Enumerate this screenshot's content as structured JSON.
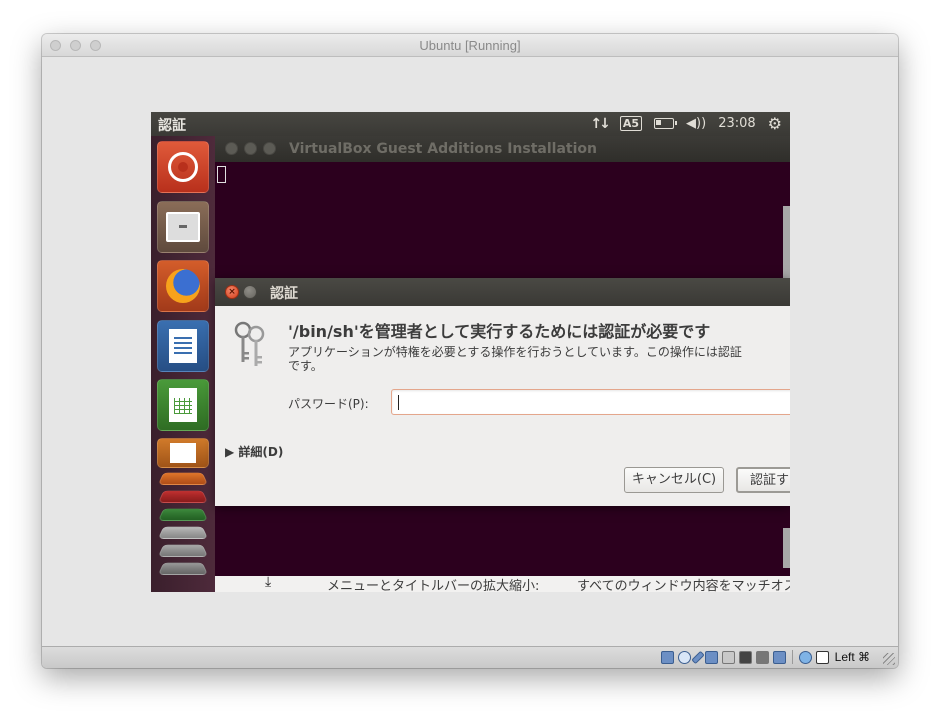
{
  "mac_window": {
    "title": "Ubuntu [Running]",
    "status_bar": {
      "host_key": "Left ⌘"
    }
  },
  "ubuntu": {
    "panel": {
      "title": "認証",
      "time": "23:08",
      "keyboard_indicator": "A5"
    },
    "launcher": {
      "items": [
        "ubuntu-dash",
        "files",
        "firefox",
        "libreoffice-writer",
        "libreoffice-calc",
        "libreoffice-impress"
      ]
    },
    "terminal": {
      "title": "VirtualBox Guest Additions Installation",
      "bottom_left": "メニューとタイトルバーの拡大縮小:",
      "bottom_right": "すべてのウィンドウ内容をマッチオス"
    },
    "dialog": {
      "title": "認証",
      "heading": "'/bin/sh'を管理者として実行するためには認証が必要です",
      "message_line1": "アプリケーションが特権を必要とする操作を行おうとしています。この操作には認証",
      "message_line2": "です。",
      "password_label": "パスワード(P):",
      "password_value": "",
      "details_label": "▶ 詳細(D)",
      "cancel_button": "キャンセル(C)",
      "auth_button": "認証す"
    }
  }
}
